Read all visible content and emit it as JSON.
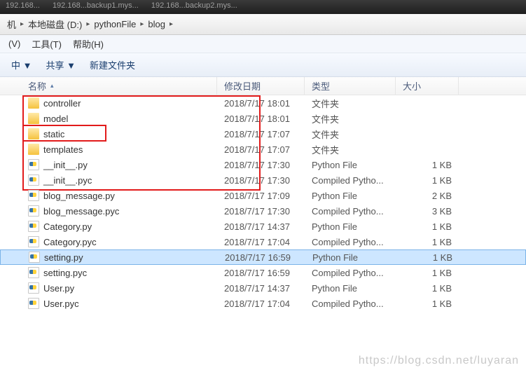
{
  "titlebar": {
    "tabs": [
      "192.168...",
      "192.168...backup1.mys...",
      "192.168...backup2.mys..."
    ]
  },
  "breadcrumb": {
    "items": [
      "机",
      "本地磁盘 (D:)",
      "pythonFile",
      "blog"
    ],
    "sep": "▸"
  },
  "menubar": {
    "view": "(V)",
    "tools": "工具(T)",
    "help": "帮助(H)"
  },
  "toolbar": {
    "include": "中 ▼",
    "share": "共享 ▼",
    "newfolder": "新建文件夹"
  },
  "columns": {
    "name": "名称",
    "date": "修改日期",
    "type": "类型",
    "size": "大小"
  },
  "files": [
    {
      "icon": "folder",
      "name": "controller",
      "date": "2018/7/17 18:01",
      "type": "文件夹",
      "size": ""
    },
    {
      "icon": "folder",
      "name": "model",
      "date": "2018/7/17 18:01",
      "type": "文件夹",
      "size": ""
    },
    {
      "icon": "folder",
      "name": "static",
      "date": "2018/7/17 17:07",
      "type": "文件夹",
      "size": ""
    },
    {
      "icon": "folder",
      "name": "templates",
      "date": "2018/7/17 17:07",
      "type": "文件夹",
      "size": ""
    },
    {
      "icon": "py",
      "name": "__init__.py",
      "date": "2018/7/17 17:30",
      "type": "Python File",
      "size": "1 KB"
    },
    {
      "icon": "pyc",
      "name": "__init__.pyc",
      "date": "2018/7/17 17:30",
      "type": "Compiled Pytho...",
      "size": "1 KB"
    },
    {
      "icon": "py",
      "name": "blog_message.py",
      "date": "2018/7/17 17:09",
      "type": "Python File",
      "size": "2 KB"
    },
    {
      "icon": "pyc",
      "name": "blog_message.pyc",
      "date": "2018/7/17 17:30",
      "type": "Compiled Pytho...",
      "size": "3 KB"
    },
    {
      "icon": "py",
      "name": "Category.py",
      "date": "2018/7/17 14:37",
      "type": "Python File",
      "size": "1 KB"
    },
    {
      "icon": "pyc",
      "name": "Category.pyc",
      "date": "2018/7/17 17:04",
      "type": "Compiled Pytho...",
      "size": "1 KB"
    },
    {
      "icon": "py",
      "name": "setting.py",
      "date": "2018/7/17 16:59",
      "type": "Python File",
      "size": "1 KB",
      "selected": true
    },
    {
      "icon": "pyc",
      "name": "setting.pyc",
      "date": "2018/7/17 16:59",
      "type": "Compiled Pytho...",
      "size": "1 KB"
    },
    {
      "icon": "py",
      "name": "User.py",
      "date": "2018/7/17 14:37",
      "type": "Python File",
      "size": "1 KB"
    },
    {
      "icon": "pyc",
      "name": "User.pyc",
      "date": "2018/7/17 17:04",
      "type": "Compiled Pytho...",
      "size": "1 KB"
    }
  ],
  "watermark": "https://blog.csdn.net/luyaran"
}
